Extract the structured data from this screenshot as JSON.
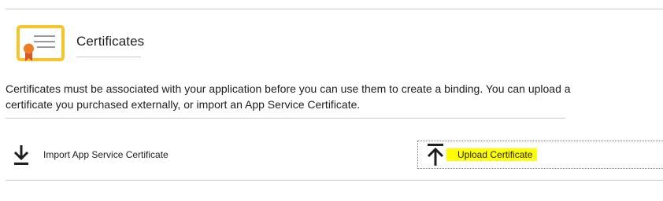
{
  "section": {
    "title": "Certificates",
    "icon": "certificate-icon",
    "description": "Certificates must be associated with your application before you can use them to create a binding. You can upload a certificate you purchased externally, or import an App Service Certificate."
  },
  "actions": {
    "import": {
      "label": "Import App Service Certificate",
      "icon": "download-icon"
    },
    "upload": {
      "label": "Upload Certificate",
      "icon": "upload-icon",
      "highlight_color": "#ffff00"
    }
  },
  "colors": {
    "certificate_frame": "#f8c42b",
    "ribbon": "#ef7d22",
    "divider": "#c8c8c8"
  }
}
